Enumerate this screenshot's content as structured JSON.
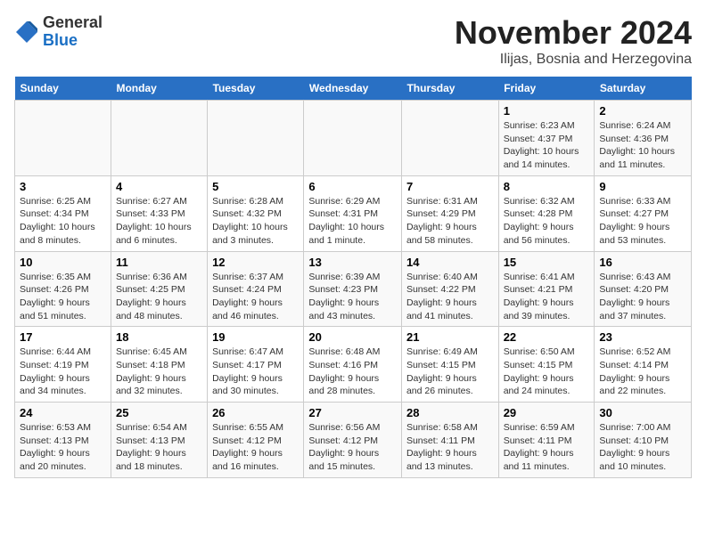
{
  "app": {
    "name_general": "General",
    "name_blue": "Blue"
  },
  "header": {
    "month_title": "November 2024",
    "subtitle": "Ilijas, Bosnia and Herzegovina"
  },
  "calendar": {
    "days_of_week": [
      "Sunday",
      "Monday",
      "Tuesday",
      "Wednesday",
      "Thursday",
      "Friday",
      "Saturday"
    ],
    "weeks": [
      [
        {
          "day": "",
          "info": ""
        },
        {
          "day": "",
          "info": ""
        },
        {
          "day": "",
          "info": ""
        },
        {
          "day": "",
          "info": ""
        },
        {
          "day": "",
          "info": ""
        },
        {
          "day": "1",
          "info": "Sunrise: 6:23 AM\nSunset: 4:37 PM\nDaylight: 10 hours and 14 minutes."
        },
        {
          "day": "2",
          "info": "Sunrise: 6:24 AM\nSunset: 4:36 PM\nDaylight: 10 hours and 11 minutes."
        }
      ],
      [
        {
          "day": "3",
          "info": "Sunrise: 6:25 AM\nSunset: 4:34 PM\nDaylight: 10 hours and 8 minutes."
        },
        {
          "day": "4",
          "info": "Sunrise: 6:27 AM\nSunset: 4:33 PM\nDaylight: 10 hours and 6 minutes."
        },
        {
          "day": "5",
          "info": "Sunrise: 6:28 AM\nSunset: 4:32 PM\nDaylight: 10 hours and 3 minutes."
        },
        {
          "day": "6",
          "info": "Sunrise: 6:29 AM\nSunset: 4:31 PM\nDaylight: 10 hours and 1 minute."
        },
        {
          "day": "7",
          "info": "Sunrise: 6:31 AM\nSunset: 4:29 PM\nDaylight: 9 hours and 58 minutes."
        },
        {
          "day": "8",
          "info": "Sunrise: 6:32 AM\nSunset: 4:28 PM\nDaylight: 9 hours and 56 minutes."
        },
        {
          "day": "9",
          "info": "Sunrise: 6:33 AM\nSunset: 4:27 PM\nDaylight: 9 hours and 53 minutes."
        }
      ],
      [
        {
          "day": "10",
          "info": "Sunrise: 6:35 AM\nSunset: 4:26 PM\nDaylight: 9 hours and 51 minutes."
        },
        {
          "day": "11",
          "info": "Sunrise: 6:36 AM\nSunset: 4:25 PM\nDaylight: 9 hours and 48 minutes."
        },
        {
          "day": "12",
          "info": "Sunrise: 6:37 AM\nSunset: 4:24 PM\nDaylight: 9 hours and 46 minutes."
        },
        {
          "day": "13",
          "info": "Sunrise: 6:39 AM\nSunset: 4:23 PM\nDaylight: 9 hours and 43 minutes."
        },
        {
          "day": "14",
          "info": "Sunrise: 6:40 AM\nSunset: 4:22 PM\nDaylight: 9 hours and 41 minutes."
        },
        {
          "day": "15",
          "info": "Sunrise: 6:41 AM\nSunset: 4:21 PM\nDaylight: 9 hours and 39 minutes."
        },
        {
          "day": "16",
          "info": "Sunrise: 6:43 AM\nSunset: 4:20 PM\nDaylight: 9 hours and 37 minutes."
        }
      ],
      [
        {
          "day": "17",
          "info": "Sunrise: 6:44 AM\nSunset: 4:19 PM\nDaylight: 9 hours and 34 minutes."
        },
        {
          "day": "18",
          "info": "Sunrise: 6:45 AM\nSunset: 4:18 PM\nDaylight: 9 hours and 32 minutes."
        },
        {
          "day": "19",
          "info": "Sunrise: 6:47 AM\nSunset: 4:17 PM\nDaylight: 9 hours and 30 minutes."
        },
        {
          "day": "20",
          "info": "Sunrise: 6:48 AM\nSunset: 4:16 PM\nDaylight: 9 hours and 28 minutes."
        },
        {
          "day": "21",
          "info": "Sunrise: 6:49 AM\nSunset: 4:15 PM\nDaylight: 9 hours and 26 minutes."
        },
        {
          "day": "22",
          "info": "Sunrise: 6:50 AM\nSunset: 4:15 PM\nDaylight: 9 hours and 24 minutes."
        },
        {
          "day": "23",
          "info": "Sunrise: 6:52 AM\nSunset: 4:14 PM\nDaylight: 9 hours and 22 minutes."
        }
      ],
      [
        {
          "day": "24",
          "info": "Sunrise: 6:53 AM\nSunset: 4:13 PM\nDaylight: 9 hours and 20 minutes."
        },
        {
          "day": "25",
          "info": "Sunrise: 6:54 AM\nSunset: 4:13 PM\nDaylight: 9 hours and 18 minutes."
        },
        {
          "day": "26",
          "info": "Sunrise: 6:55 AM\nSunset: 4:12 PM\nDaylight: 9 hours and 16 minutes."
        },
        {
          "day": "27",
          "info": "Sunrise: 6:56 AM\nSunset: 4:12 PM\nDaylight: 9 hours and 15 minutes."
        },
        {
          "day": "28",
          "info": "Sunrise: 6:58 AM\nSunset: 4:11 PM\nDaylight: 9 hours and 13 minutes."
        },
        {
          "day": "29",
          "info": "Sunrise: 6:59 AM\nSunset: 4:11 PM\nDaylight: 9 hours and 11 minutes."
        },
        {
          "day": "30",
          "info": "Sunrise: 7:00 AM\nSunset: 4:10 PM\nDaylight: 9 hours and 10 minutes."
        }
      ]
    ]
  }
}
